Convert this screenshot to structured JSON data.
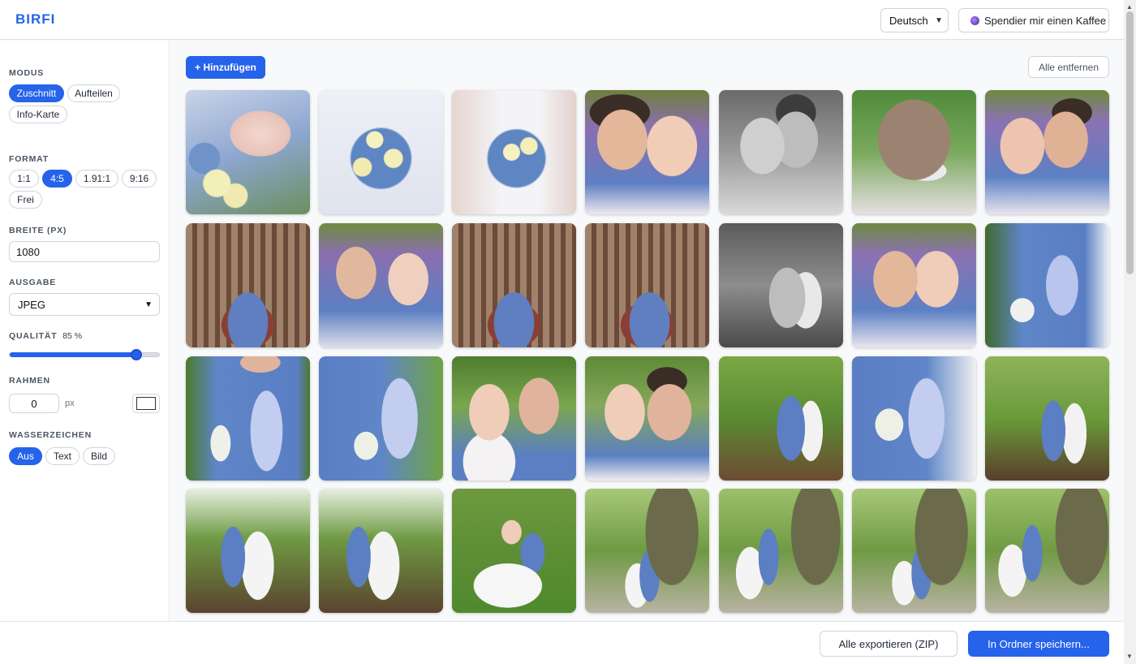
{
  "header": {
    "logo": "BIRFI",
    "language": "Deutsch",
    "coffee_label": "Spendier mir einen Kaffee"
  },
  "sidebar": {
    "mode_label": "MODUS",
    "modes": [
      "Zuschnitt",
      "Aufteilen",
      "Info-Karte"
    ],
    "format_label": "FORMAT",
    "formats": [
      "1:1",
      "4:5",
      "1.91:1",
      "9:16",
      "Frei"
    ],
    "width_label": "BREITE (PX)",
    "width_value": "1080",
    "output_label": "AUSGABE",
    "output_value": "JPEG",
    "quality_label": "QUALITÄT",
    "quality_value": "85 %",
    "quality_fraction": 0.85,
    "frame_label": "RAHMEN",
    "frame_value": "0",
    "frame_unit": "px",
    "frame_color": "#ffffff",
    "watermark_label": "WASSERZEICHEN",
    "watermarks": [
      "Aus",
      "Text",
      "Bild"
    ]
  },
  "main": {
    "add_label": "+ Hinzufügen",
    "remove_all_label": "Alle entfernen"
  },
  "footer": {
    "export_label": "Alle exportieren (ZIP)",
    "save_label": "In Ordner speichern..."
  },
  "colors": {
    "accent": "#2563eb"
  }
}
